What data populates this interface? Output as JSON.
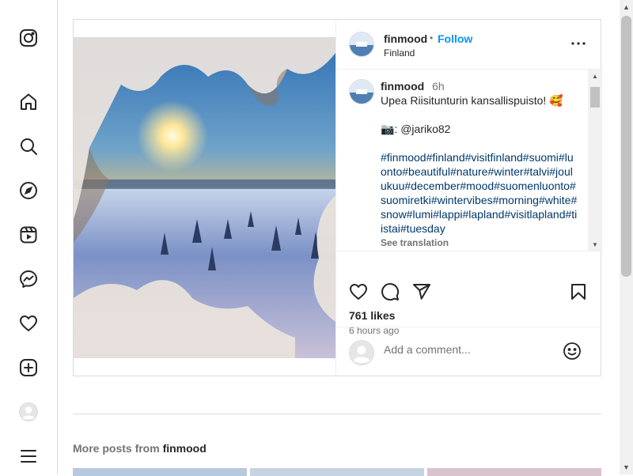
{
  "post": {
    "username": "finmood",
    "follow_separator": "•",
    "follow_label": "Follow",
    "location": "Finland",
    "caption": {
      "username": "finmood",
      "time": "6h",
      "text": "Upea Riisitunturin kansallispuisto! 🥰",
      "credit": "📷: @jariko82",
      "hashtags": "#finmood#finland#visitfinland#suomi#luonto#beautiful#nature#winter#talvi#joulukuu#december#mood#suomenluonto#suomiretki#wintervibes#morning#white#snow#lumi#lappi#lapland#visitlapland#tiistai#tuesday",
      "see_translation": "See translation"
    },
    "likes": "761 likes",
    "posted_ago": "6 hours ago",
    "comment_placeholder": "Add a comment..."
  },
  "more_posts": {
    "prefix": "More posts from",
    "username": "finmood"
  },
  "icons": {
    "sidebar": [
      "instagram-icon",
      "home-icon",
      "search-icon",
      "explore-icon",
      "reels-icon",
      "messenger-icon",
      "notifications-icon",
      "create-icon",
      "profile-avatar",
      "menu-icon"
    ],
    "actions": [
      "like-icon",
      "comment-icon",
      "share-icon",
      "save-icon",
      "emoji-icon"
    ]
  },
  "colors": {
    "accent": "#0095f6",
    "hashtag": "#00376b",
    "muted": "#737373",
    "border": "#dbdbdb"
  }
}
